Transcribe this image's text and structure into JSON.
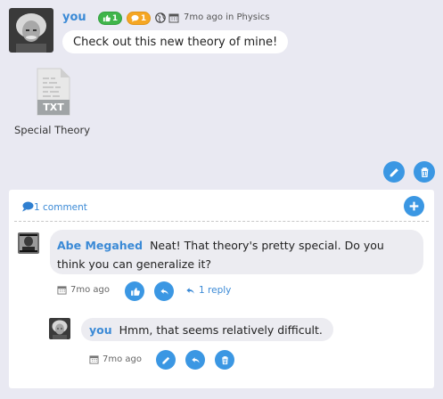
{
  "post": {
    "author": "you",
    "upvotes": "1",
    "comments_badge": "1",
    "time": "7mo ago",
    "location_prefix": "in",
    "location": "Physics",
    "message": "Check out this new theory of mine!",
    "attachment": {
      "type_label": "TXT",
      "name": "Special Theory"
    }
  },
  "comments_section": {
    "count_label": "1 comment"
  },
  "comment": {
    "author": "Abe Megahed",
    "text": "Neat! That theory's pretty special. Do you think you can generalize it?",
    "time": "7mo ago",
    "reply_label": "1 reply"
  },
  "reply": {
    "author": "you",
    "text": "Hmm, that seems relatively difficult.",
    "time": "7mo ago"
  },
  "colors": {
    "accent": "#3b97e3",
    "link": "#3b8ad6",
    "upvote_badge": "#3fb54a",
    "comment_badge": "#f5a623"
  }
}
